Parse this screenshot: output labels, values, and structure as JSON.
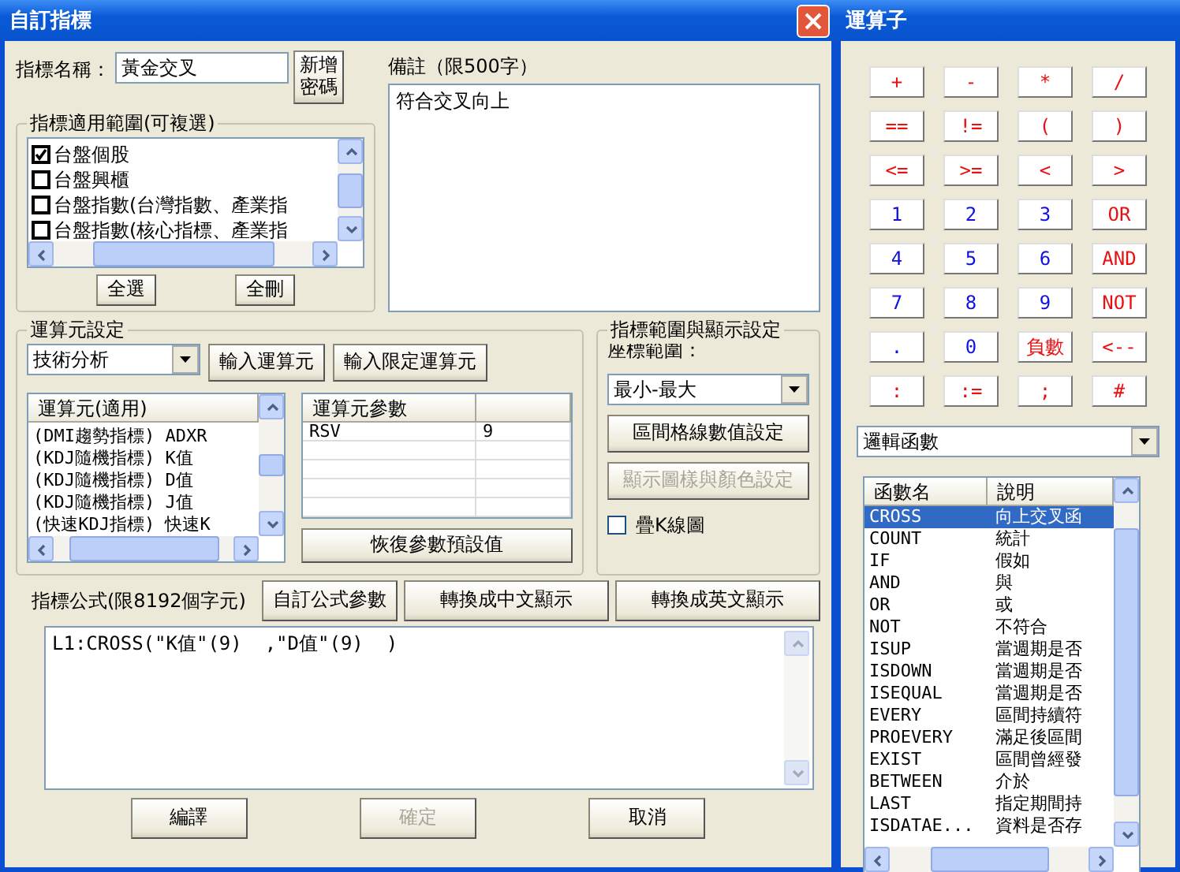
{
  "window": {
    "title": "自訂指標"
  },
  "name_field": {
    "label": "指標名稱：",
    "value": "黃金交叉"
  },
  "new_password_button": [
    "新增",
    "密碼"
  ],
  "scope": {
    "legend": "指標適用範圍(可複選)",
    "items": [
      {
        "label": "台盤個股",
        "checked": true
      },
      {
        "label": "台盤興櫃",
        "checked": false
      },
      {
        "label": "台盤指數(台灣指數、產業指",
        "checked": false
      },
      {
        "label": "台盤指數(核心指標、產業指",
        "checked": false
      }
    ],
    "buttons": [
      "全選",
      "全刪"
    ]
  },
  "note": {
    "label": "備註（限500字）",
    "value": "符合交叉向上"
  },
  "operand_settings": {
    "legend": "運算元設定",
    "category": "技術分析",
    "buttons": [
      "輸入運算元",
      "輸入限定運算元"
    ],
    "operand_list": {
      "header": "運算元(適用)",
      "items": [
        "(DMI趨勢指標) ADXR",
        "(KDJ隨機指標) K值",
        "(KDJ隨機指標) D值",
        "(KDJ隨機指標) J值",
        "(快速KDJ指標) 快速K"
      ]
    },
    "param_table": {
      "columns": [
        "運算元參數"
      ],
      "rows": [
        {
          "name": "RSV",
          "value": "9"
        }
      ]
    },
    "reset_button": "恢復參數預設值"
  },
  "display_settings": {
    "legend": "指標範圍與顯示設定",
    "range_label": "座標範圍：",
    "range_value": "最小-最大",
    "buttons": [
      {
        "label": "區間格線數值設定",
        "disabled": false
      },
      {
        "label": "顯示圖樣與顏色設定",
        "disabled": true
      }
    ],
    "overlay": {
      "label": "疊K線圖",
      "checked": false
    }
  },
  "formula": {
    "label": "指標公式(限8192個字元)",
    "buttons": [
      "自訂公式參數",
      "轉換成中文顯示",
      "轉換成英文顯示"
    ],
    "value": "L1:CROSS(\"K值\"(9)  ,\"D值\"(9)  )"
  },
  "footer_buttons": [
    {
      "label": "編譯",
      "disabled": false
    },
    {
      "label": "確定",
      "disabled": true
    },
    {
      "label": "取消",
      "disabled": false
    }
  ],
  "operator_window": {
    "title": "運算子",
    "keys": [
      {
        "label": "+",
        "kind": "operator"
      },
      {
        "label": "-",
        "kind": "operator"
      },
      {
        "label": "*",
        "kind": "operator"
      },
      {
        "label": "/",
        "kind": "operator"
      },
      {
        "label": "==",
        "kind": "operator"
      },
      {
        "label": "!=",
        "kind": "operator"
      },
      {
        "label": "(",
        "kind": "operator"
      },
      {
        "label": ")",
        "kind": "operator"
      },
      {
        "label": "<=",
        "kind": "operator"
      },
      {
        "label": ">=",
        "kind": "operator"
      },
      {
        "label": "<",
        "kind": "operator"
      },
      {
        "label": ">",
        "kind": "operator"
      },
      {
        "label": "1",
        "kind": "digit"
      },
      {
        "label": "2",
        "kind": "digit"
      },
      {
        "label": "3",
        "kind": "digit"
      },
      {
        "label": "OR",
        "kind": "operator"
      },
      {
        "label": "4",
        "kind": "digit"
      },
      {
        "label": "5",
        "kind": "digit"
      },
      {
        "label": "6",
        "kind": "digit"
      },
      {
        "label": "AND",
        "kind": "operator"
      },
      {
        "label": "7",
        "kind": "digit"
      },
      {
        "label": "8",
        "kind": "digit"
      },
      {
        "label": "9",
        "kind": "digit"
      },
      {
        "label": "NOT",
        "kind": "operator"
      },
      {
        "label": ".",
        "kind": "digit"
      },
      {
        "label": "0",
        "kind": "digit"
      },
      {
        "label": "負數",
        "kind": "operator"
      },
      {
        "label": "<--",
        "kind": "operator"
      },
      {
        "label": ":",
        "kind": "operator"
      },
      {
        "label": ":=",
        "kind": "operator"
      },
      {
        "label": ";",
        "kind": "operator"
      },
      {
        "label": "#",
        "kind": "operator"
      }
    ],
    "category": "邏輯函數",
    "function_list": {
      "columns": [
        "函數名",
        "說明"
      ],
      "rows": [
        {
          "name": "CROSS",
          "description": "向上交叉函",
          "selected": true
        },
        {
          "name": "COUNT",
          "description": "統計",
          "selected": false
        },
        {
          "name": "IF",
          "description": "假如",
          "selected": false
        },
        {
          "name": "AND",
          "description": "與",
          "selected": false
        },
        {
          "name": "OR",
          "description": "或",
          "selected": false
        },
        {
          "name": "NOT",
          "description": "不符合",
          "selected": false
        },
        {
          "name": "ISUP",
          "description": "當週期是否",
          "selected": false
        },
        {
          "name": "ISDOWN",
          "description": "當週期是否",
          "selected": false
        },
        {
          "name": "ISEQUAL",
          "description": "當週期是否",
          "selected": false
        },
        {
          "name": "EVERY",
          "description": "區間持續符",
          "selected": false
        },
        {
          "name": "PROEVERY",
          "description": "滿足後區間",
          "selected": false
        },
        {
          "name": "EXIST",
          "description": "區間曾經發",
          "selected": false
        },
        {
          "name": "BETWEEN",
          "description": "介於",
          "selected": false
        },
        {
          "name": "LAST",
          "description": "指定期間持",
          "selected": false
        },
        {
          "name": "ISDATAE...",
          "description": "資料是否存",
          "selected": false
        }
      ]
    }
  }
}
